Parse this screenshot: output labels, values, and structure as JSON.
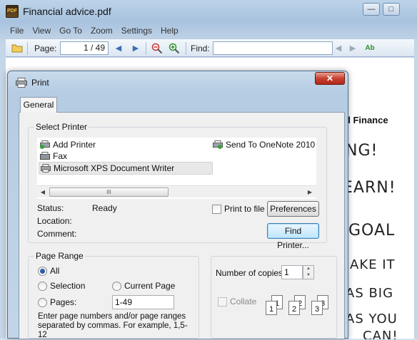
{
  "window": {
    "title": "Financial advice.pdf",
    "app_icon_text": "PDF",
    "minimize_glyph": "—",
    "maximize_glyph": "□"
  },
  "menu": [
    "File",
    "View",
    "Go To",
    "Zoom",
    "Settings",
    "Help"
  ],
  "toolbar": {
    "page_label": "Page:",
    "page_value": "1 / 49",
    "find_label": "Find:",
    "find_value": ""
  },
  "document": {
    "heading_fragment": "al Finance",
    "handwriting": [
      "NG!",
      "EARN!",
      "GOAL",
      "AKE IT",
      "AS BIG",
      "AS YOU",
      "CAN!"
    ]
  },
  "dialog": {
    "title": "Print",
    "close_glyph": "✕",
    "tab": "General",
    "select_printer": {
      "label": "Select Printer",
      "printers": [
        "Add Printer",
        "Fax",
        "Microsoft XPS Document Writer",
        "Send To OneNote 2010"
      ],
      "selected": "Microsoft XPS Document Writer",
      "scroll_grip": "III"
    },
    "status_label": "Status:",
    "status_value": "Ready",
    "location_label": "Location:",
    "comment_label": "Comment:",
    "print_to_file": "Print to file",
    "preferences": "Preferences",
    "find_printer": "Find Printer...",
    "page_range": {
      "label": "Page Range",
      "all": "All",
      "selection": "Selection",
      "current_page": "Current Page",
      "pages": "Pages:",
      "pages_value": "1-49",
      "hint": "Enter page numbers and/or page ranges separated by commas.  For example, 1,5-12",
      "selected": "All"
    },
    "copies": {
      "label": "Number of copies:",
      "value": "1",
      "collate": "Collate"
    }
  }
}
